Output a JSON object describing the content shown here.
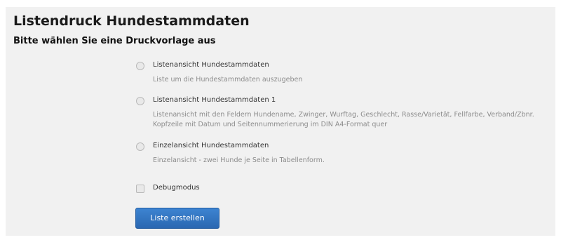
{
  "page": {
    "title": "Listendruck Hundestammdaten",
    "subtitle": "Bitte wählen Sie eine Druckvorlage aus"
  },
  "options": [
    {
      "type": "radio",
      "label": "Listenansicht Hundestammdaten",
      "description": "Liste um die Hundestammdaten auszugeben",
      "checked": false
    },
    {
      "type": "radio",
      "label": "Listenansicht Hundestammdaten 1",
      "description": "Listenansicht mit den Feldern Hundename, Zwinger, Wurftag, Geschlecht, Rasse/Varietät, Fellfarbe, Verband/Zbnr. Kopfzeile mit Datum und Seitennummerierung im DIN A4-Format quer",
      "checked": false
    },
    {
      "type": "radio",
      "label": "Einzelansicht Hundestammdaten",
      "description": "Einzelansicht - zwei Hunde je Seite in Tabellenform.",
      "checked": false
    },
    {
      "type": "checkbox",
      "label": "Debugmodus",
      "checked": false
    }
  ],
  "actions": {
    "submit_label": "Liste erstellen"
  },
  "colors": {
    "panel_background": "#f1f1f1",
    "button_background": "#2f72c0",
    "button_text": "#ffffff",
    "description_text": "#8c8c8c"
  }
}
